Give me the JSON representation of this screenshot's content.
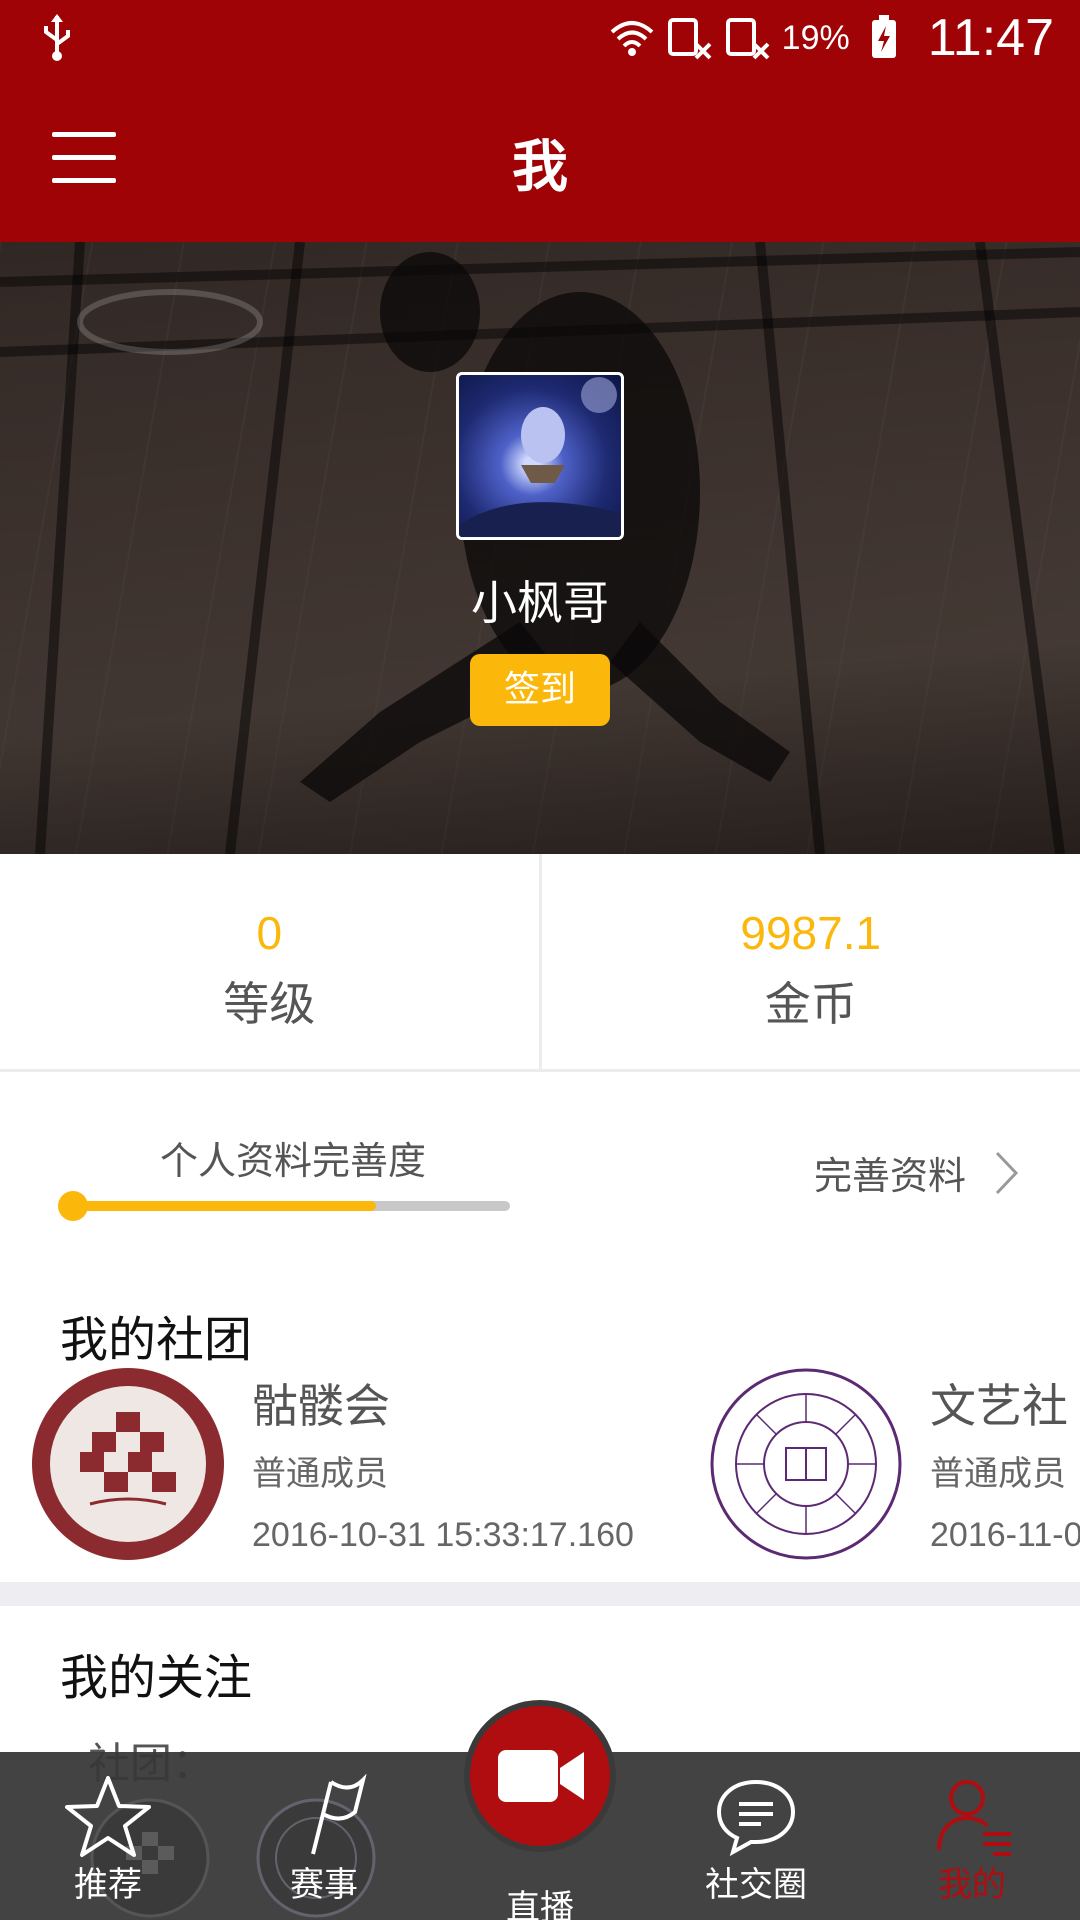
{
  "status_bar": {
    "battery_percent": "19%",
    "time": "11:47"
  },
  "app_bar": {
    "title": "我"
  },
  "profile_header": {
    "username": "小枫哥",
    "checkin_label": "签到"
  },
  "stats": [
    {
      "value": "0",
      "label": "等级"
    },
    {
      "value": "9987.1",
      "label": "金币"
    }
  ],
  "completeness": {
    "label": "个人资料完善度",
    "progress": 0.7,
    "link_label": "完善资料"
  },
  "my_clubs": {
    "title": "我的社团",
    "items": [
      {
        "name": "骷髅会",
        "role": "普通成员",
        "date": "2016-10-31 15:33:17.160"
      },
      {
        "name": "文艺社",
        "role": "普通成员",
        "date": "2016-11-0"
      }
    ]
  },
  "my_follows": {
    "title": "我的关注",
    "clubs_label": "社团："
  },
  "bottom_nav": {
    "items": [
      {
        "label": "推荐",
        "icon": "star-icon"
      },
      {
        "label": "赛事",
        "icon": "flag-icon"
      },
      {
        "label": "直播",
        "icon": "video-camera-icon"
      },
      {
        "label": "社交圈",
        "icon": "chat-bubble-icon"
      },
      {
        "label": "我的",
        "icon": "user-icon"
      }
    ],
    "active_index": 4
  },
  "colors": {
    "primary": "#a00305",
    "accent": "#fbb80b",
    "nav_bg": "#373737",
    "active_nav": "#b00d10"
  }
}
